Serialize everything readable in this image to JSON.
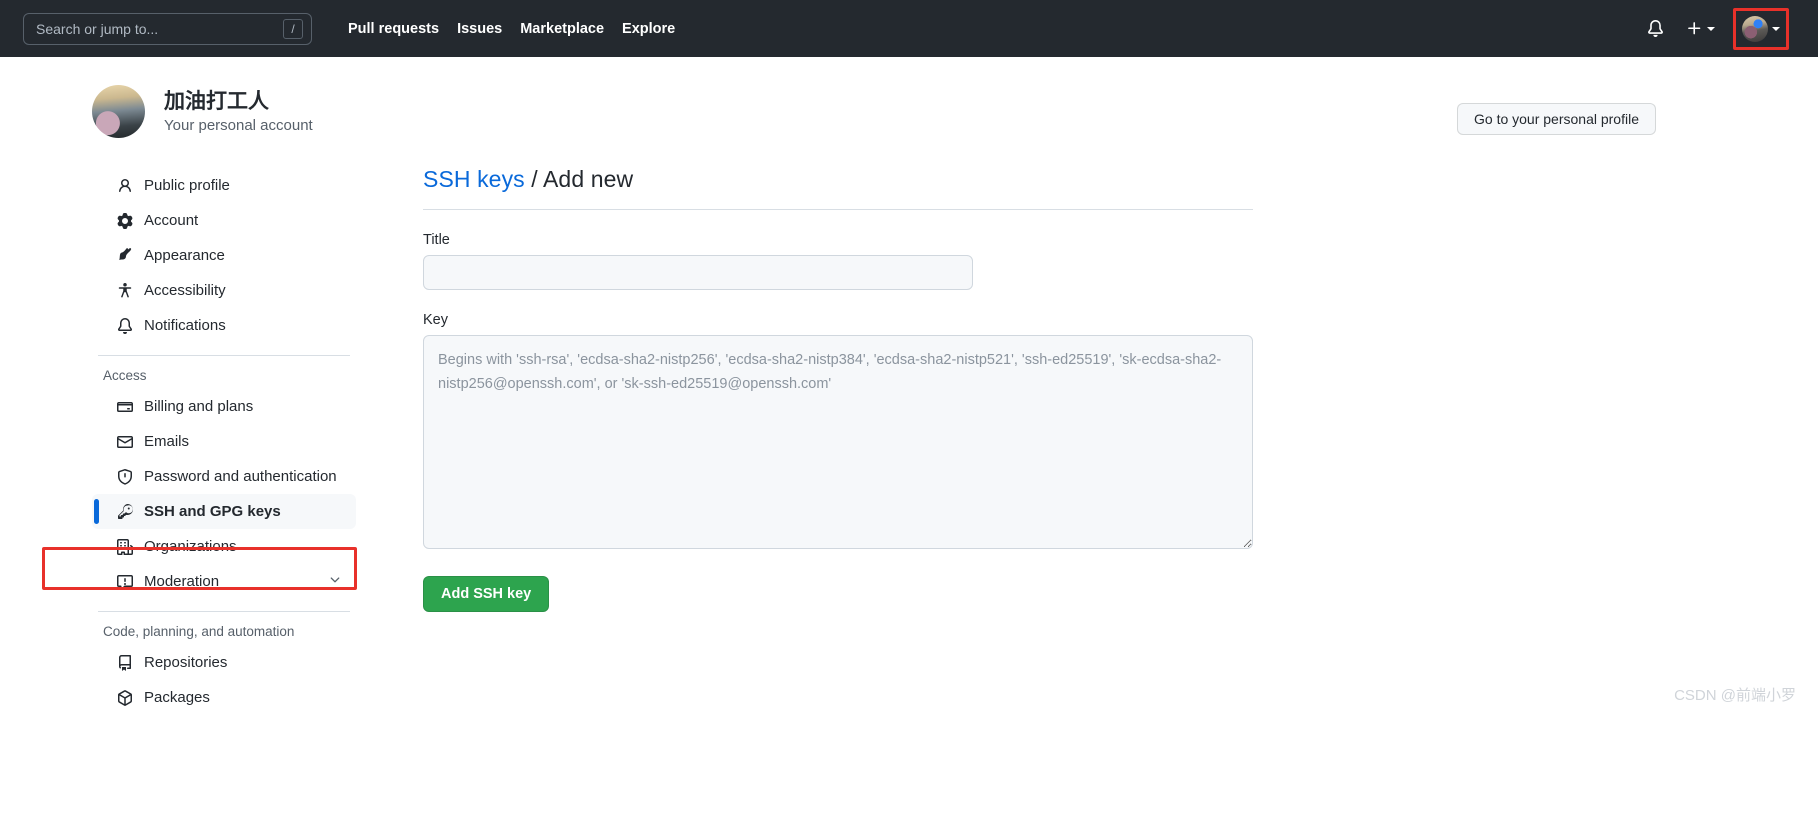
{
  "header": {
    "search_placeholder": "Search or jump to...",
    "search_shortcut": "/",
    "nav": [
      {
        "label": "Pull requests"
      },
      {
        "label": "Issues"
      },
      {
        "label": "Marketplace"
      },
      {
        "label": "Explore"
      }
    ],
    "icons": {
      "bell": "bell-icon",
      "plus": "plus-icon",
      "avatar": "user-avatar"
    }
  },
  "profile": {
    "name": "加油打工人",
    "subtitle": "Your personal account",
    "go_to_profile_label": "Go to your personal profile"
  },
  "sidebar": {
    "groups": [
      {
        "title": "",
        "items": [
          {
            "label": "Public profile",
            "icon": "person-icon",
            "active": false
          },
          {
            "label": "Account",
            "icon": "gear-icon",
            "active": false
          },
          {
            "label": "Appearance",
            "icon": "paintbrush-icon",
            "active": false
          },
          {
            "label": "Accessibility",
            "icon": "accessibility-icon",
            "active": false
          },
          {
            "label": "Notifications",
            "icon": "bell-icon",
            "active": false
          }
        ]
      },
      {
        "title": "Access",
        "items": [
          {
            "label": "Billing and plans",
            "icon": "credit-card-icon",
            "active": false
          },
          {
            "label": "Emails",
            "icon": "mail-icon",
            "active": false
          },
          {
            "label": "Password and authentication",
            "icon": "shield-icon",
            "active": false
          },
          {
            "label": "SSH and GPG keys",
            "icon": "key-icon",
            "active": true
          },
          {
            "label": "Organizations",
            "icon": "organization-icon",
            "active": false
          },
          {
            "label": "Moderation",
            "icon": "report-icon",
            "active": false,
            "chevron": true
          }
        ]
      },
      {
        "title": "Code, planning, and automation",
        "items": [
          {
            "label": "Repositories",
            "icon": "repo-icon",
            "active": false
          },
          {
            "label": "Packages",
            "icon": "package-icon",
            "active": false
          }
        ]
      }
    ]
  },
  "main": {
    "title_link": "SSH keys",
    "title_separator": " / ",
    "title_rest": "Add new",
    "title_label": "Title",
    "title_value": "",
    "title_placeholder": "",
    "key_label": "Key",
    "key_value": "",
    "key_placeholder": "Begins with 'ssh-rsa', 'ecdsa-sha2-nistp256', 'ecdsa-sha2-nistp384', 'ecdsa-sha2-nistp521', 'ssh-ed25519', 'sk-ecdsa-sha2-nistp256@openssh.com', or 'sk-ssh-ed25519@openssh.com'",
    "submit_label": "Add SSH key"
  },
  "watermark": "CSDN @前端小罗",
  "colors": {
    "header_bg": "#24292f",
    "accent_blue": "#0969da",
    "button_green": "#2da44e",
    "highlight_red": "#e8312a",
    "field_bg": "#f6f8fa"
  }
}
